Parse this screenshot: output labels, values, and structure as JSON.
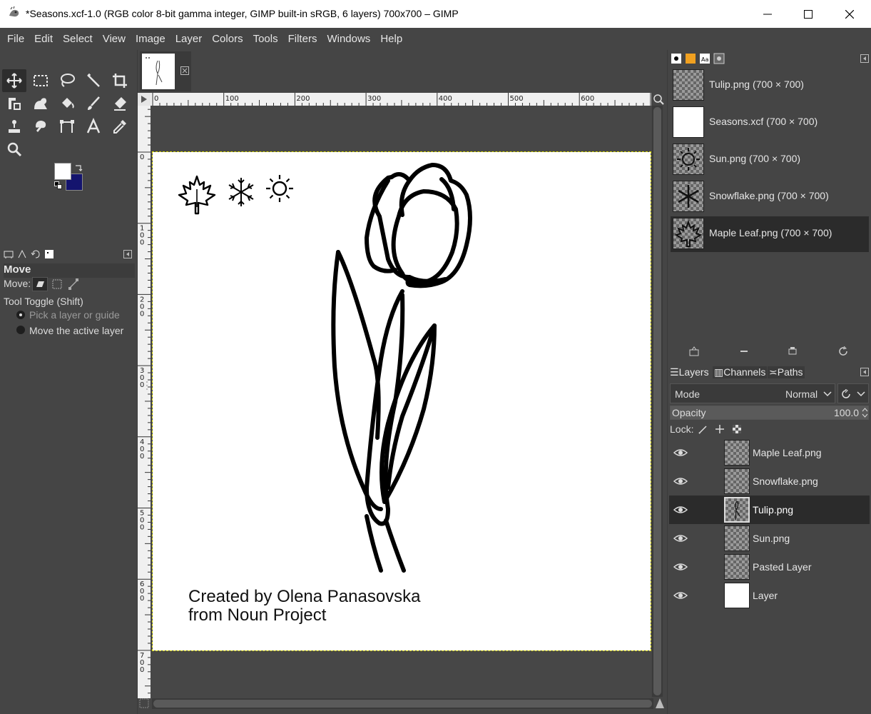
{
  "window": {
    "title": "*Seasons.xcf-1.0 (RGB color 8-bit gamma integer, GIMP built-in sRGB, 6 layers) 700x700 – GIMP",
    "minimize_glyph": "—",
    "maximize_glyph": "☐",
    "close_glyph": "✕"
  },
  "menu": [
    "File",
    "Edit",
    "Select",
    "View",
    "Image",
    "Layer",
    "Colors",
    "Tools",
    "Filters",
    "Windows",
    "Help"
  ],
  "tools": [
    "move-tool",
    "rect-select-tool",
    "lasso-tool",
    "fuzzy-select-tool",
    "crop-tool",
    "transform-tool",
    "warp-tool",
    "bucket-fill-tool",
    "paintbrush-tool",
    "eraser-tool",
    "clone-tool",
    "smudge-tool",
    "path-tool",
    "text-tool",
    "color-picker-tool",
    "zoom-tool"
  ],
  "colors": {
    "foreground": "#ffffff",
    "background": "#14146e"
  },
  "tool_options": {
    "title": "Move",
    "move_label": "Move:",
    "tool_toggle": "Tool Toggle  (Shift)",
    "option_pick": "Pick a layer or guide",
    "option_move_active": "Move the active layer"
  },
  "ruler": {
    "top_labels": [
      "0",
      "100",
      "200",
      "300",
      "400",
      "500",
      "600"
    ],
    "left_labels": [
      "0",
      "1\n0\n0",
      "2\n0\n0",
      "3\n0\n0",
      "4\n0\n0",
      "5\n0\n0",
      "6\n0\n0",
      "7\n0\n0"
    ]
  },
  "canvas": {
    "credit_line1": "Created by Olena Panasovska",
    "credit_line2": "from Noun Project"
  },
  "images_panel": {
    "items": [
      {
        "label": "Tulip.png (700 × 700)",
        "thumb": "tulip"
      },
      {
        "label": "Seasons.xcf (700 × 700)",
        "thumb": "white"
      },
      {
        "label": "Sun.png (700 × 700)",
        "thumb": "sun"
      },
      {
        "label": "Snowflake.png (700 × 700)",
        "thumb": "snowflake"
      },
      {
        "label": "Maple Leaf.png (700 × 700)",
        "thumb": "leaf"
      }
    ],
    "selected_index": 4
  },
  "layers_panel": {
    "tabs": [
      "Layers",
      "Channels",
      "Paths"
    ],
    "mode_label": "Mode",
    "mode_value": "Normal",
    "opacity_label": "Opacity",
    "opacity_value": "100.0",
    "lock_label": "Lock:",
    "layers": [
      {
        "name": "Maple Leaf.png",
        "thumb": "checker"
      },
      {
        "name": "Snowflake.png",
        "thumb": "checker"
      },
      {
        "name": "Tulip.png",
        "thumb": "tulip"
      },
      {
        "name": "Sun.png",
        "thumb": "checker"
      },
      {
        "name": "Pasted Layer",
        "thumb": "checker"
      },
      {
        "name": "Layer",
        "thumb": "white"
      }
    ],
    "selected_index": 2
  }
}
